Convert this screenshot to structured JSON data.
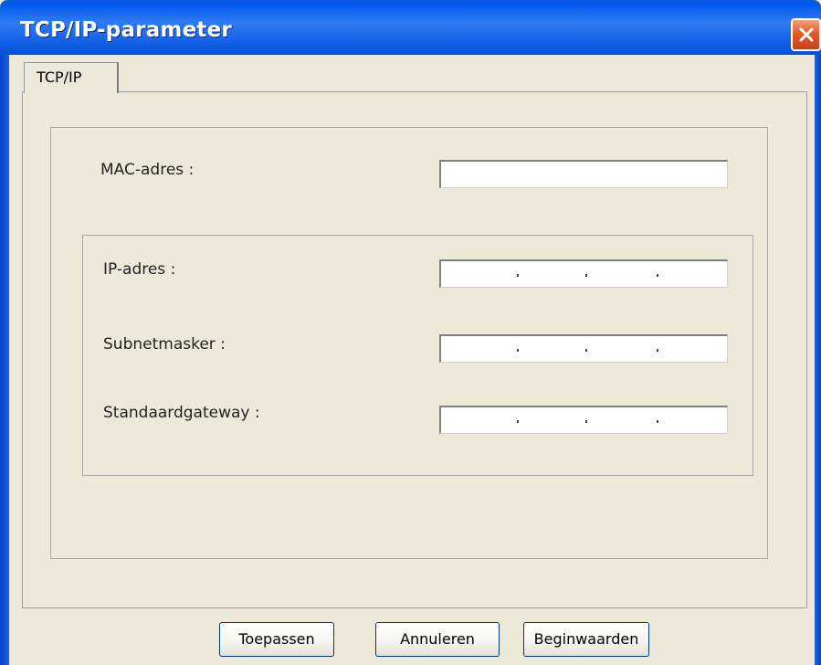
{
  "window": {
    "title": "TCP/IP-parameter"
  },
  "tabs": [
    {
      "label": "TCP/IP"
    }
  ],
  "form": {
    "mac_label": "MAC-adres :",
    "mac_value": "",
    "ip_label": "IP-adres :",
    "ip_value": "   .   .   .",
    "subnet_label": "Subnetmasker :",
    "subnet_value": "   .   .   .",
    "gateway_label": "Standaardgateway :",
    "gateway_value": "   .   .   ."
  },
  "buttons": {
    "apply": "Toepassen",
    "cancel": "Annuleren",
    "defaults": "Beginwaarden"
  },
  "icons": {
    "close": "close-icon"
  },
  "colors": {
    "titlebar": "#1a66ea",
    "close_button": "#e25a2d",
    "background": "#ece9d8"
  }
}
